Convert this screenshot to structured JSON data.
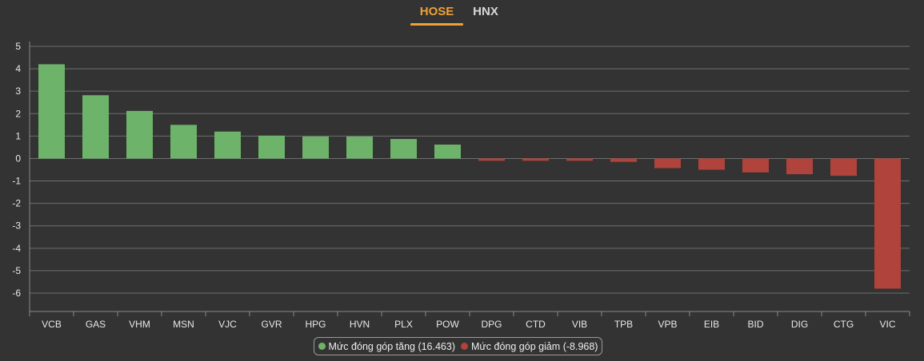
{
  "tabs": [
    {
      "label": "HOSE",
      "active": true
    },
    {
      "label": "HNX",
      "active": false
    }
  ],
  "colors": {
    "positive": "#6db46a",
    "negative": "#b0433b",
    "active_tab": "#f0a035",
    "background": "#333333"
  },
  "legend": {
    "positive_label": "Mức đóng góp tăng (16.463)",
    "negative_label": "Mức đóng góp giảm (-8.968)"
  },
  "chart_data": {
    "type": "bar",
    "categories": [
      "VCB",
      "GAS",
      "VHM",
      "MSN",
      "VJC",
      "GVR",
      "HPG",
      "HVN",
      "PLX",
      "POW",
      "DPG",
      "CTD",
      "VIB",
      "TPB",
      "VPB",
      "EIB",
      "BID",
      "DIG",
      "CTG",
      "VIC"
    ],
    "values": [
      4.2,
      2.82,
      2.12,
      1.5,
      1.2,
      1.02,
      0.98,
      0.98,
      0.87,
      0.62,
      -0.1,
      -0.1,
      -0.1,
      -0.15,
      -0.43,
      -0.5,
      -0.62,
      -0.7,
      -0.77,
      -5.8
    ],
    "ylim": [
      -6.8,
      5
    ],
    "yticks": [
      5,
      4,
      3,
      2,
      1,
      0,
      -1,
      -2,
      -3,
      -4,
      -5,
      -6
    ],
    "grid": true,
    "legend_position": "bottom-center"
  }
}
